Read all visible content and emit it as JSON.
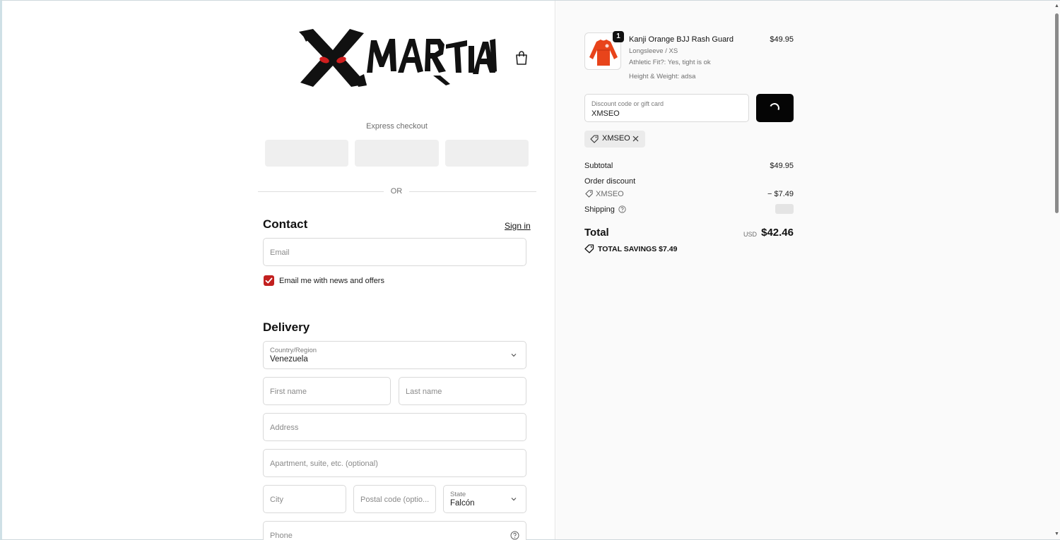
{
  "brand": {
    "name": "XMARTIAL"
  },
  "express": {
    "label": "Express checkout",
    "divider": "OR"
  },
  "contact": {
    "title": "Contact",
    "sign_in": "Sign in",
    "email_placeholder": "Email",
    "newsletter_label": "Email me with news and offers",
    "newsletter_checked": true
  },
  "delivery": {
    "title": "Delivery",
    "country_label": "Country/Region",
    "country_value": "Venezuela",
    "first_name_placeholder": "First name",
    "last_name_placeholder": "Last name",
    "address_placeholder": "Address",
    "apartment_placeholder": "Apartment, suite, etc. (optional)",
    "city_placeholder": "City",
    "postal_placeholder": "Postal code (optio...",
    "state_label": "State",
    "state_value": "Falcón",
    "phone_placeholder": "Phone"
  },
  "cart": {
    "item": {
      "name": "Kanji Orange BJJ Rash Guard",
      "quantity": "1",
      "variant": "Longsleeve / XS",
      "fit": "Athletic Fit?: Yes, tight is ok",
      "height_weight": "Height & Weight: adsa",
      "price": "$49.95"
    },
    "discount_label": "Discount code or gift card",
    "discount_value": "XMSEO",
    "applied_code": "XMSEO",
    "subtotal_label": "Subtotal",
    "subtotal_value": "$49.95",
    "order_discount_label": "Order discount",
    "order_discount_code": "XMSEO",
    "order_discount_value": "− $7.49",
    "shipping_label": "Shipping",
    "total_label": "Total",
    "currency": "USD",
    "total_value": "$42.46",
    "savings": "TOTAL SAVINGS  $7.49"
  },
  "colors": {
    "accent": "#c2201f",
    "button": "#050505",
    "panel": "#fafafa"
  }
}
